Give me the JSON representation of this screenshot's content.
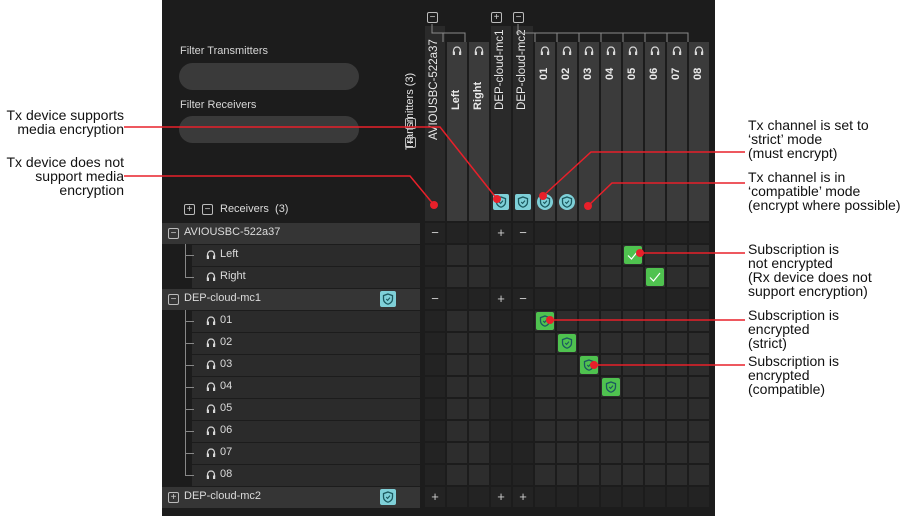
{
  "filters": {
    "transmitters_label": "Filter Transmitters",
    "receivers_label": "Filter Receivers",
    "transmitters_value": "",
    "receivers_value": ""
  },
  "transmitters": {
    "title": "Transmitters",
    "count": "(3)",
    "devices": [
      {
        "name": "AVIOUSBC-522a37",
        "channels": [
          "Left",
          "Right"
        ]
      },
      {
        "name": "DEP-cloud-mc1",
        "channels": []
      },
      {
        "name": "DEP-cloud-mc2",
        "channels": [
          "01",
          "02",
          "03",
          "04",
          "05",
          "06",
          "07",
          "08"
        ]
      }
    ]
  },
  "receivers": {
    "title": "Receivers",
    "count": "(3)",
    "devices": [
      {
        "name": "AVIOUSBC-522a37",
        "expanded": true,
        "encryption": false,
        "channels": [
          "Left",
          "Right"
        ]
      },
      {
        "name": "DEP-cloud-mc1",
        "expanded": true,
        "encryption": true,
        "channels": [
          "01",
          "02",
          "03",
          "04",
          "05",
          "06",
          "07",
          "08"
        ]
      },
      {
        "name": "DEP-cloud-mc2",
        "expanded": false,
        "encryption": true,
        "channels": []
      }
    ]
  },
  "icons": {
    "expand": "plus-box-icon",
    "collapse": "minus-box-icon",
    "channel": "headphones-icon",
    "encryption": "shield-icon",
    "subscribed": "checkmark-icon"
  },
  "colors": {
    "subscribed": "#4fc24f",
    "encryption": "#7fd0d8",
    "annotation": "#e8202a"
  },
  "annotations": {
    "tx_supports": "Tx device supports\nmedia encryption",
    "tx_not_support": "Tx device does not\nsupport media\nencryption",
    "tx_strict": "Tx channel is set to\n‘strict’ mode\n(must encrypt)",
    "tx_compatible": "Tx channel is in\n‘compatible’ mode\n(encrypt where possible)",
    "sub_not_encrypted": "Subscription is\nnot encrypted\n(Rx device does not\nsupport encryption)",
    "sub_strict": "Subscription is\nencrypted\n(strict)",
    "sub_compatible": "Subscription is\nencrypted\n(compatible)"
  }
}
